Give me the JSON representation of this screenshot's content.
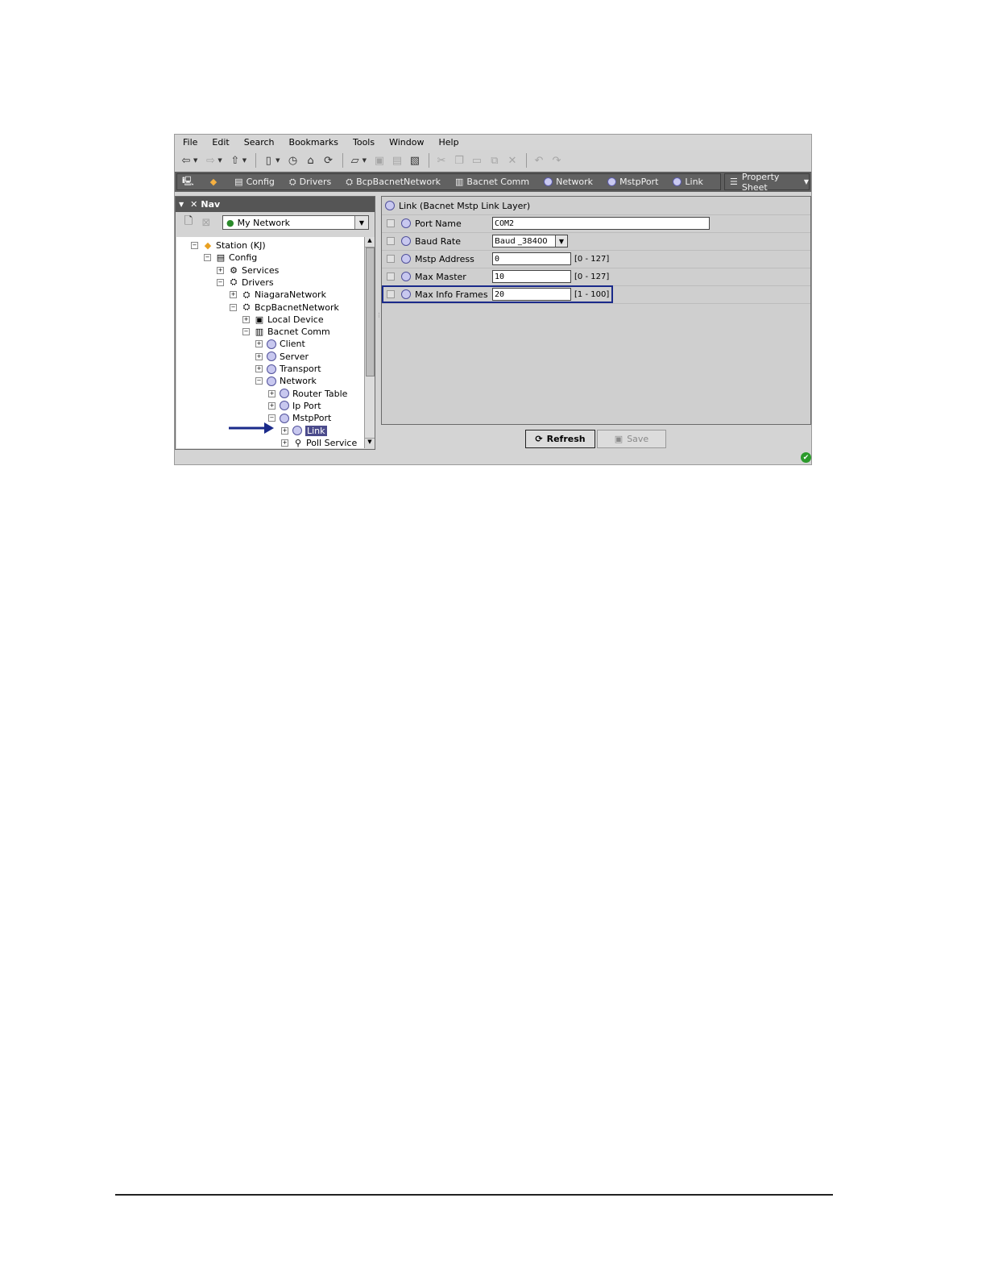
{
  "menu": [
    "File",
    "Edit",
    "Search",
    "Bookmarks",
    "Tools",
    "Window",
    "Help"
  ],
  "toolbar_icons": [
    "back-icon",
    "forward-icon",
    "up-icon",
    "side-bar-icon",
    "history-icon",
    "home-icon",
    "refresh-icon",
    "open-icon",
    "save-icon",
    "save-all-icon",
    "save-bog-icon",
    "cut-icon",
    "copy-icon",
    "paste-icon",
    "duplicate-icon",
    "delete-icon",
    "undo-icon",
    "redo-icon"
  ],
  "breadcrumbs": [
    "Config",
    "Drivers",
    "BcpBacnetNetwork",
    "Bacnet Comm",
    "Network",
    "MstpPort",
    "Link"
  ],
  "view_select": "Property Sheet",
  "nav": {
    "title": "Nav",
    "selector": "My Network",
    "tree": [
      {
        "label": "Station (KJ)",
        "level": 0
      },
      {
        "label": "Config",
        "level": 1
      },
      {
        "label": "Services",
        "level": 2
      },
      {
        "label": "Drivers",
        "level": 2
      },
      {
        "label": "NiagaraNetwork",
        "level": 3
      },
      {
        "label": "BcpBacnetNetwork",
        "level": 3
      },
      {
        "label": "Local Device",
        "level": 4
      },
      {
        "label": "Bacnet Comm",
        "level": 4
      },
      {
        "label": "Client",
        "level": 5
      },
      {
        "label": "Server",
        "level": 5
      },
      {
        "label": "Transport",
        "level": 5
      },
      {
        "label": "Network",
        "level": 5
      },
      {
        "label": "Router Table",
        "level": 6
      },
      {
        "label": "Ip Port",
        "level": 6
      },
      {
        "label": "MstpPort",
        "level": 6
      },
      {
        "label": "Link",
        "level": 7
      },
      {
        "label": "Poll Service",
        "level": 7
      }
    ]
  },
  "property_sheet": {
    "header": "Link  (Bacnet Mstp Link Layer)",
    "rows": [
      {
        "label": "Port Name",
        "value": "COM2",
        "range": ""
      },
      {
        "label": "Baud Rate",
        "value": "Baud _38400",
        "range": ""
      },
      {
        "label": "Mstp Address",
        "value": "0",
        "range": "[0 - 127]"
      },
      {
        "label": "Max Master",
        "value": "10",
        "range": "[0 - 127]"
      },
      {
        "label": "Max Info Frames",
        "value": "20",
        "range": "[1 - 100]"
      }
    ]
  },
  "buttons": {
    "refresh": "Refresh",
    "save": "Save"
  }
}
